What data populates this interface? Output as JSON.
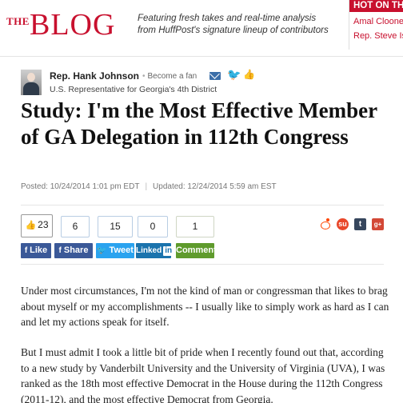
{
  "header": {
    "logo_the": "THE",
    "logo_blog": "BLOG",
    "tagline": "Featuring fresh takes and real-time analysis from HuffPost's signature lineup of contributors",
    "hot_title": "HOT ON THE",
    "hot_items": [
      "Amal Cloone",
      "Rep. Steve Is"
    ]
  },
  "author": {
    "name": "Rep. Hank Johnson",
    "become_fan": "Become a fan",
    "title": "U.S. Representative for Georgia's 4th District"
  },
  "article": {
    "headline": "Study: I'm the Most Effective Member of GA Delegation in 112th Congress",
    "posted": "Posted: 10/24/2014 1:01 pm EDT",
    "updated": "Updated: 12/24/2014 5:59 am EST",
    "paragraphs": [
      "Under most circumstances, I'm not the kind of man or congressman that likes to brag about myself or my accomplishments -- I usually like to simply work as hard as I can and let my actions speak for itself.",
      "But I must admit I took a little bit of pride when I recently found out that, according to a new study by Vanderbilt University and the University of Virginia (UVA), I was ranked as the 18th most effective Democrat in the House during the 112th Congress (2011-12), and the most effective Democrat from Georgia."
    ]
  },
  "share": {
    "like_count": "23",
    "counts": {
      "share": "6",
      "tweet": "15",
      "linkedin": "0",
      "comment": "1"
    },
    "labels": {
      "like": "Like",
      "share": "Share",
      "tweet": "Tweet",
      "linkedin": "Linked",
      "linkedin_in": "in",
      "comment": "Comment"
    },
    "icons": {
      "facebook": "f",
      "stumbleupon": "su",
      "tumblr": "t",
      "gplus": "g+"
    }
  },
  "colors": {
    "brand": "#c8102e",
    "facebook": "#3b5998",
    "twitter": "#2aa3ef",
    "linkedin": "#1a73ad",
    "comment": "#5f9b2c"
  }
}
